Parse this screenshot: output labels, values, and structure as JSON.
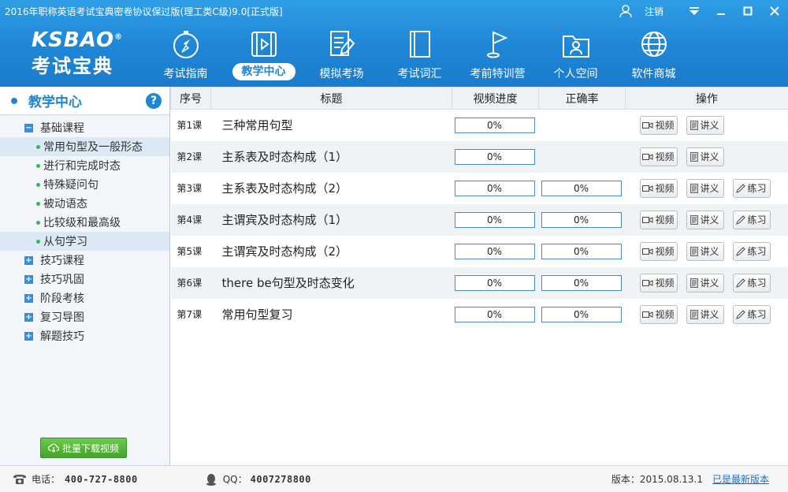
{
  "window": {
    "title": "2016年职称英语考试宝典密卷协议保过版(理工类C级)9.0[正式版]",
    "logout_label": "注销"
  },
  "logo": {
    "en": "KSBAO",
    "mark": "®",
    "cn": "考试宝典"
  },
  "nav": [
    {
      "label": "考试指南",
      "icon": "compass-icon"
    },
    {
      "label": "教学中心",
      "icon": "video-icon",
      "active": true
    },
    {
      "label": "模拟考场",
      "icon": "pencil-paper-icon"
    },
    {
      "label": "考试词汇",
      "icon": "book-icon"
    },
    {
      "label": "考前特训营",
      "icon": "flag-icon"
    },
    {
      "label": "个人空间",
      "icon": "user-folder-icon"
    },
    {
      "label": "软件商城",
      "icon": "globe-icon"
    }
  ],
  "sidebar": {
    "title": "教学中心",
    "help": "?",
    "groups": [
      {
        "label": "基础课程",
        "toggle": "−",
        "children": [
          "常用句型及一般形态",
          "进行和完成时态",
          "特殊疑问句",
          "被动语态",
          "比较级和最高级",
          "从句学习"
        ]
      },
      {
        "label": "技巧课程",
        "toggle": "+"
      },
      {
        "label": "技巧巩固",
        "toggle": "+"
      },
      {
        "label": "阶段考核",
        "toggle": "+"
      },
      {
        "label": "复习导图",
        "toggle": "+"
      },
      {
        "label": "解题技巧",
        "toggle": "+"
      }
    ],
    "batch_download": "批量下载视频"
  },
  "table": {
    "headers": [
      "序号",
      "标题",
      "视频进度",
      "正确率",
      "操作"
    ],
    "op_labels": {
      "video": "视频",
      "notes": "讲义",
      "practice": "练习"
    },
    "rows": [
      {
        "num": "第1课",
        "title": "三种常用句型",
        "video_progress": "0%",
        "accuracy": "",
        "has_practice": false
      },
      {
        "num": "第2课",
        "title": "主系表及时态构成（1）",
        "video_progress": "0%",
        "accuracy": "",
        "has_practice": false
      },
      {
        "num": "第3课",
        "title": "主系表及时态构成（2）",
        "video_progress": "0%",
        "accuracy": "0%",
        "has_practice": true
      },
      {
        "num": "第4课",
        "title": "主谓宾及时态构成（1）",
        "video_progress": "0%",
        "accuracy": "0%",
        "has_practice": true
      },
      {
        "num": "第5课",
        "title": "主谓宾及时态构成（2）",
        "video_progress": "0%",
        "accuracy": "0%",
        "has_practice": true
      },
      {
        "num": "第6课",
        "title": "there be句型及时态变化",
        "video_progress": "0%",
        "accuracy": "0%",
        "has_practice": true
      },
      {
        "num": "第7课",
        "title": "常用句型复习",
        "video_progress": "0%",
        "accuracy": "0%",
        "has_practice": true
      }
    ]
  },
  "footer": {
    "phone_label": "电话：",
    "phone": "400-727-8800",
    "qq_label": "QQ：",
    "qq": "4007278800",
    "version_label": "版本：",
    "version": "2015.08.13.1",
    "latest": "已是最新版本"
  },
  "colors": {
    "brand": "#1f86d6",
    "green": "#43a52d"
  }
}
